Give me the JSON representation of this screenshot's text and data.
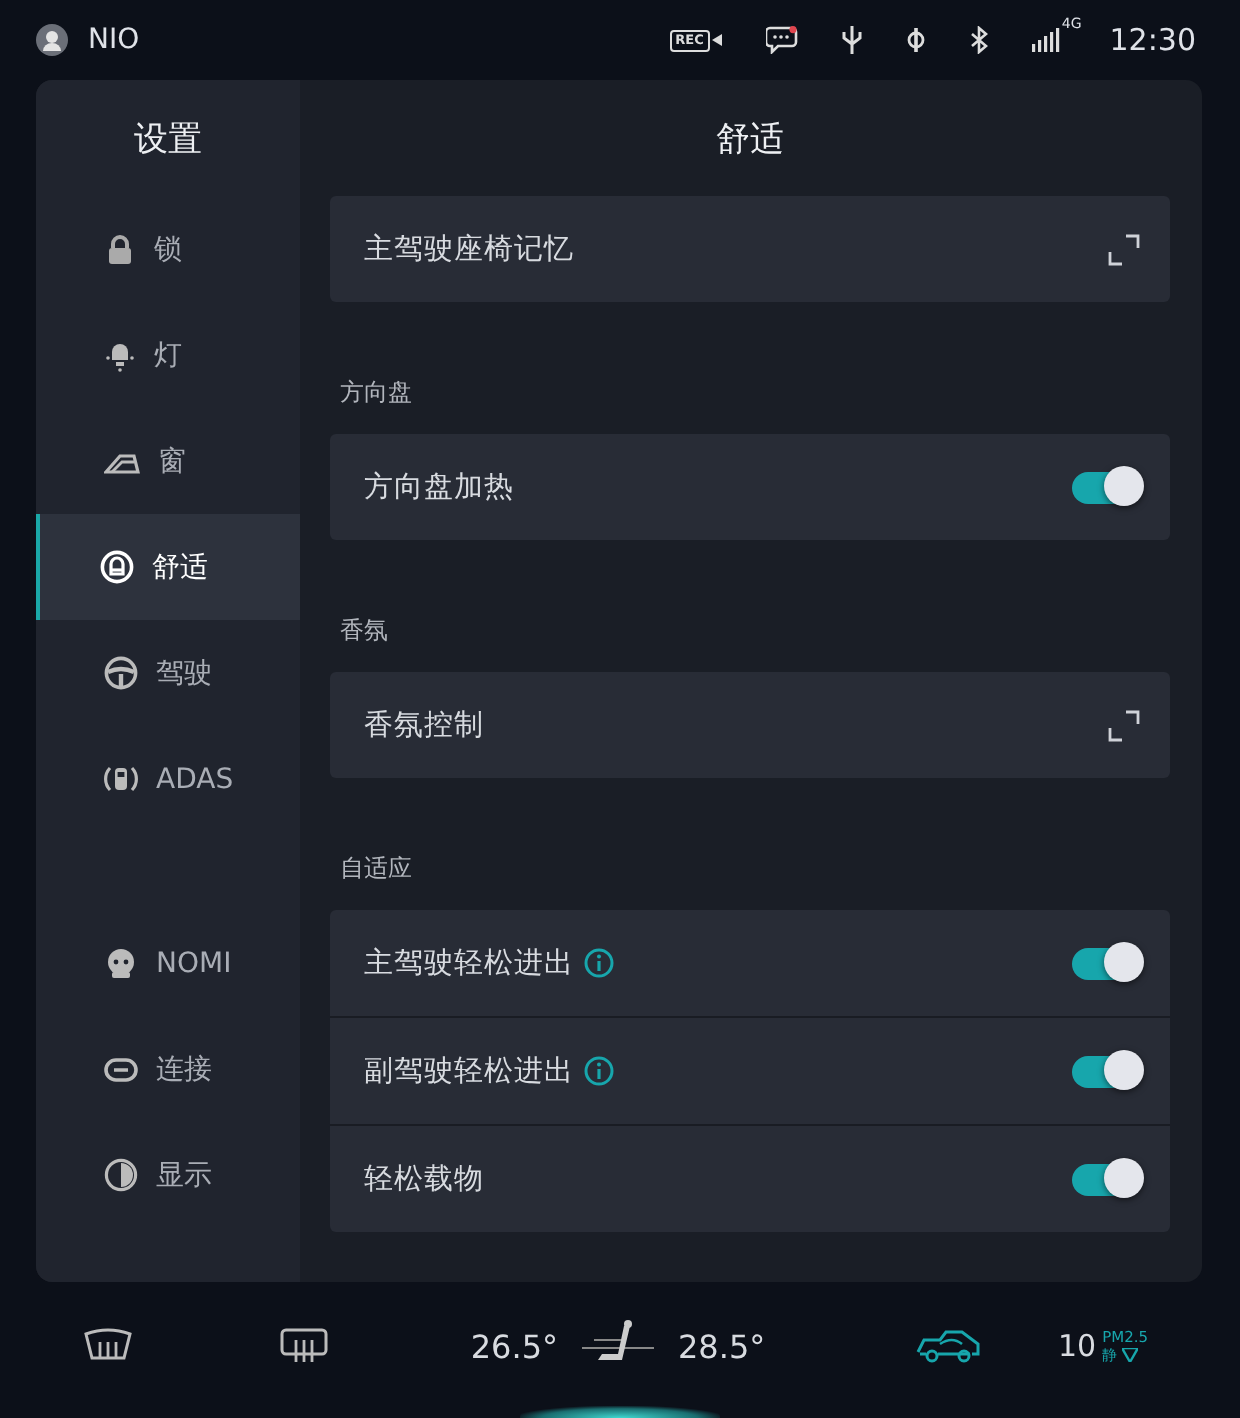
{
  "status_bar": {
    "user": "NIO",
    "rec_badge": "REC",
    "network": "4G",
    "time": "12:30"
  },
  "sidebar": {
    "title": "设置",
    "groups": [
      [
        {
          "label": "锁",
          "kind": "lock",
          "selected": false
        },
        {
          "label": "灯",
          "kind": "bulb",
          "selected": false
        },
        {
          "label": "窗",
          "kind": "window",
          "selected": false
        },
        {
          "label": "舒适",
          "kind": "comfort",
          "selected": true
        },
        {
          "label": "驾驶",
          "kind": "wheel",
          "selected": false
        },
        {
          "label": "ADAS",
          "kind": "adas",
          "selected": false
        }
      ],
      [
        {
          "label": "NOMI",
          "kind": "nomi",
          "selected": false
        },
        {
          "label": "连接",
          "kind": "link",
          "selected": false
        },
        {
          "label": "显示",
          "kind": "display",
          "selected": false
        }
      ]
    ]
  },
  "content": {
    "title": "舒适",
    "sections": [
      {
        "rows": [
          {
            "label": "主驾驶座椅记忆",
            "kind": "expand"
          }
        ]
      },
      {
        "label": "方向盘",
        "rows": [
          {
            "label": "方向盘加热",
            "kind": "toggle",
            "on": true
          }
        ]
      },
      {
        "label": "香氛",
        "rows": [
          {
            "label": "香氛控制",
            "kind": "expand"
          }
        ]
      },
      {
        "label": "自适应",
        "rows": [
          {
            "label": "主驾驶轻松进出",
            "kind": "toggle",
            "on": true,
            "info": true
          },
          {
            "label": "副驾驶轻松进出",
            "kind": "toggle",
            "on": true,
            "info": true
          },
          {
            "label": "轻松载物",
            "kind": "toggle",
            "on": true
          }
        ]
      }
    ]
  },
  "climate": {
    "left_temp": "26.5°",
    "right_temp": "28.5°",
    "pm_value": "10",
    "pm_label": "PM2.5",
    "pm_mode": "静"
  }
}
